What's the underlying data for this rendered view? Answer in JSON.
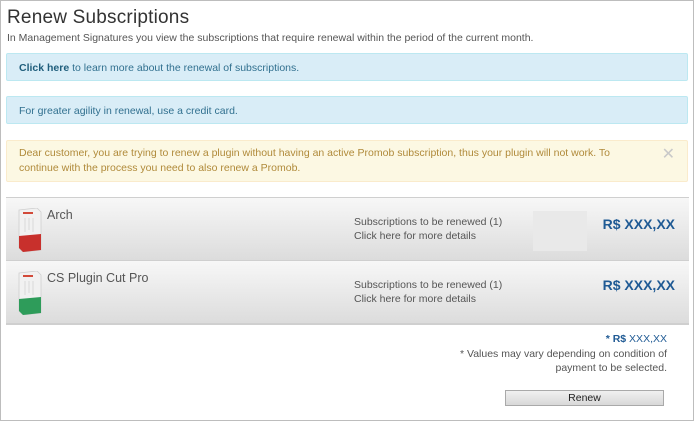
{
  "page": {
    "title": "Renew Subscriptions",
    "subtitle": "In Management Signatures you view the subscriptions that require renewal within the period of the current month."
  },
  "alerts": {
    "learn_more_link": "Click here",
    "learn_more_text": " to learn more about the renewal of subscriptions.",
    "credit_card_text": "For greater agility in renewal, use a credit card.",
    "warning_text": "Dear customer, you are trying to renew a plugin without having an active Promob subscription, thus your plugin will not work. To continue with the process you need to also renew a Promob.",
    "warning_close_glyph": "✕"
  },
  "items": [
    {
      "name": "Arch",
      "subscriptions_label": "Subscriptions to be renewed (1)",
      "details_link": "Click here for more details",
      "price": "R$  XXX,XX",
      "box_color": "#c8302c"
    },
    {
      "name": "CS Plugin Cut Pro",
      "subscriptions_label": "Subscriptions to be renewed (1)",
      "details_link": "Click here for more details",
      "price": "R$ XXX,XX",
      "box_color": "#2e9c5a"
    }
  ],
  "totals": {
    "total_prefix": "* R$",
    "total_value": " XXX,XX",
    "note_line1": "* Values may vary depending on condition of",
    "note_line2": "payment to be selected."
  },
  "actions": {
    "renew_label": "Renew"
  },
  "colors": {
    "price": "#1f5a94",
    "info_bg": "#d9edf7",
    "warning_bg": "#fcf8e3"
  }
}
